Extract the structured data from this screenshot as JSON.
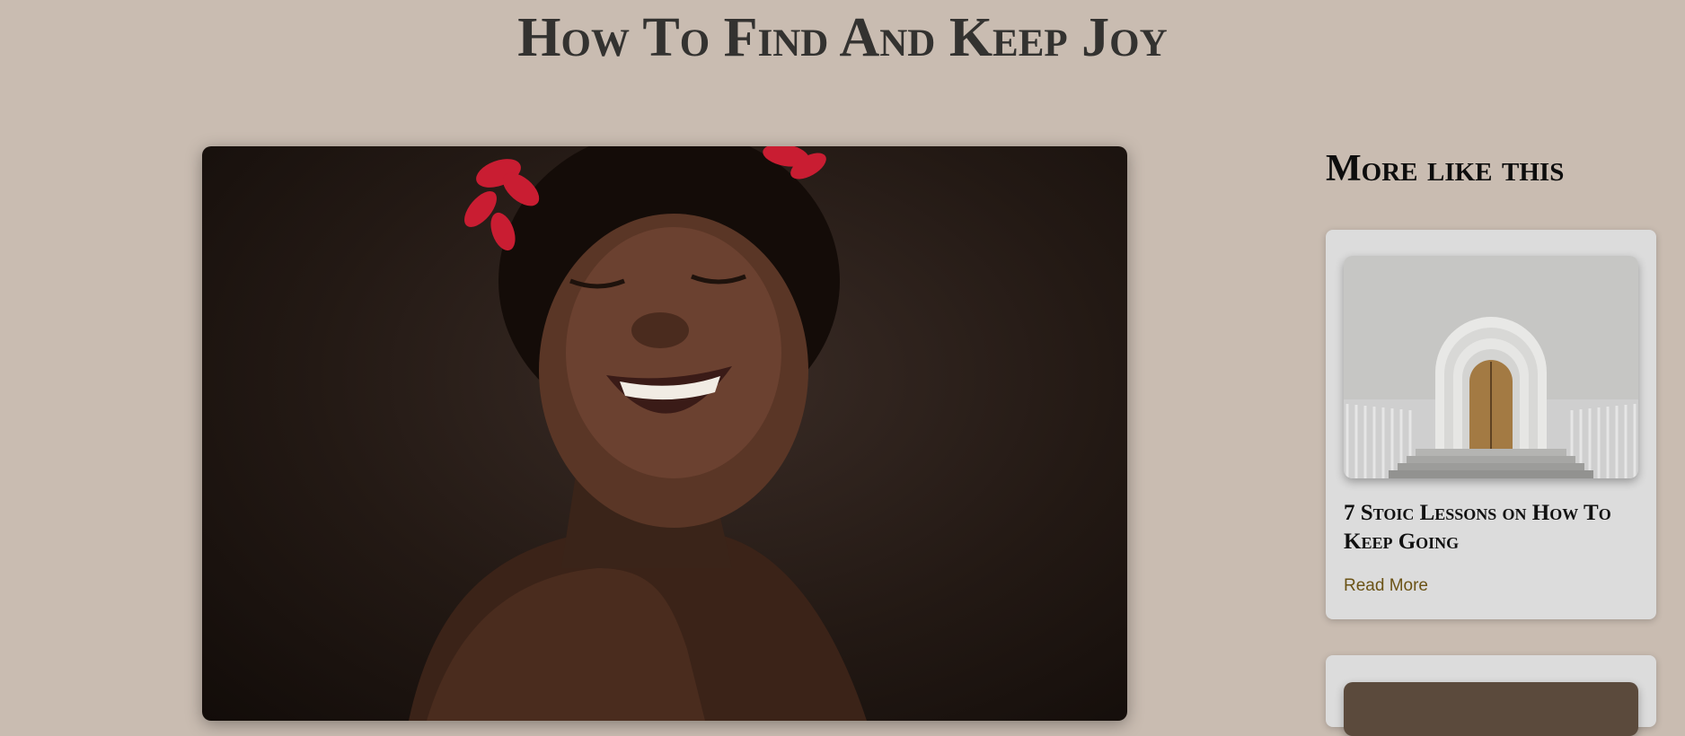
{
  "article": {
    "title": "How To Find And Keep Joy"
  },
  "sidebar": {
    "heading": "More like this",
    "cards": [
      {
        "title": "7 Stoic Lessons on How To Keep Going",
        "link_label": "Read More"
      }
    ]
  }
}
